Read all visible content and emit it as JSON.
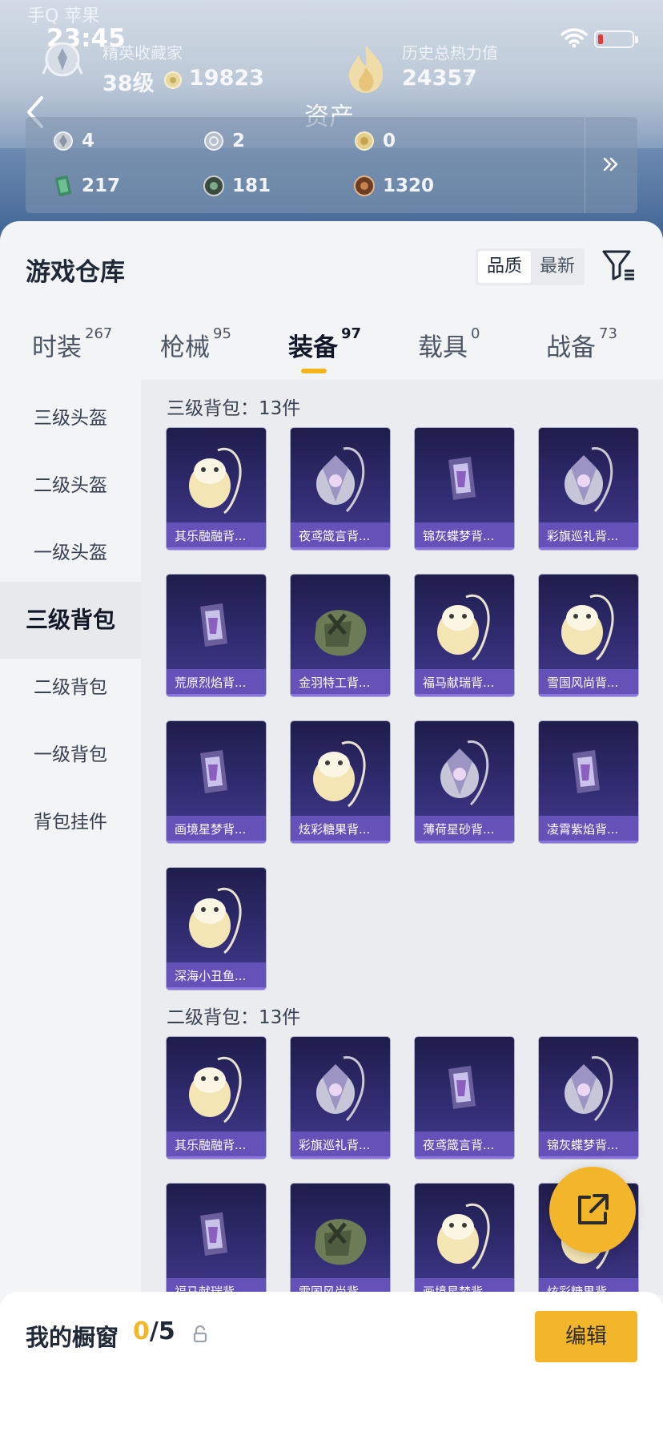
{
  "status_bar": {
    "carrier": "手Q 苹果",
    "time": "23:45"
  },
  "header": {
    "collector_label": "精英收藏家",
    "level": "38级",
    "coins": "19823",
    "heat_label": "历史总热力值",
    "heat_value": "24357",
    "heat_help": "?",
    "page_title": "资产"
  },
  "assets": [
    {
      "icon": "silver-token-icon",
      "value": "4"
    },
    {
      "icon": "silver-coin-icon",
      "value": "2"
    },
    {
      "icon": "gold-coin-icon",
      "value": "0"
    },
    {
      "icon": "green-card-icon",
      "value": "217"
    },
    {
      "icon": "dark-orb-icon",
      "value": "181"
    },
    {
      "icon": "bronze-orb-icon",
      "value": "1320"
    }
  ],
  "warehouse": {
    "title": "游戏仓库",
    "sort_quality": "品质",
    "sort_newest": "最新",
    "tabs": [
      {
        "label": "时装",
        "count": "267"
      },
      {
        "label": "枪械",
        "count": "95"
      },
      {
        "label": "装备",
        "count": "97",
        "active": true
      },
      {
        "label": "载具",
        "count": "0"
      },
      {
        "label": "战备",
        "count": "73"
      }
    ],
    "sidebar": [
      "三级头盔",
      "二级头盔",
      "一级头盔",
      "三级背包",
      "二级背包",
      "一级背包",
      "背包挂件"
    ],
    "sections": [
      {
        "title": "三级背包：13件",
        "items": [
          "其乐融融背...",
          "夜鸢箴言背...",
          "锦灰蝶梦背...",
          "彩旗巡礼背...",
          "荒原烈焰背...",
          "金羽特工背...",
          "福马献瑞背...",
          "雪国风尚背...",
          "画境星梦背...",
          "炫彩糖果背...",
          "薄荷星砂背...",
          "凌霄紫焰背...",
          "深海小丑鱼..."
        ]
      },
      {
        "title": "二级背包：13件",
        "items": [
          "其乐融融背...",
          "彩旗巡礼背...",
          "夜鸢箴言背...",
          "锦灰蝶梦背...",
          "福马献瑞背...",
          "雪国风尚背...",
          "画境星梦背...",
          "炫彩糖果背..."
        ]
      }
    ]
  },
  "showcase": {
    "title": "我的橱窗",
    "current": "0",
    "total": "/5",
    "edit_label": "编辑"
  },
  "colors": {
    "accent": "#f3b52a",
    "card_bg": "#2c2868",
    "card_label": "#6552b8"
  }
}
